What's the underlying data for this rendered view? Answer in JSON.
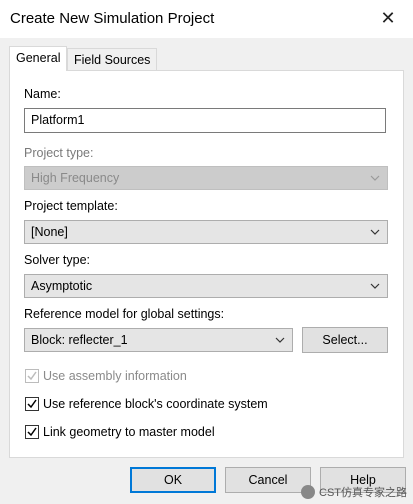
{
  "window": {
    "title": "Create New Simulation Project",
    "close_symbol": "✕"
  },
  "tabs": [
    {
      "label": "General",
      "selected": true
    },
    {
      "label": "Field Sources",
      "selected": false
    }
  ],
  "form": {
    "name_label": "Name:",
    "name_value": "Platform1",
    "project_type_label": "Project type:",
    "project_type_value": "High Frequency",
    "project_template_label": "Project template:",
    "project_template_value": "[None]",
    "solver_type_label": "Solver type:",
    "solver_type_value": "Asymptotic",
    "reference_model_label": "Reference model for global settings:",
    "reference_model_value": "Block: reflecter_1",
    "select_button": "Select...",
    "use_assembly_info": {
      "label": "Use assembly information",
      "checked": true,
      "enabled": false
    },
    "use_reference_block_cs": {
      "label": "Use reference block's coordinate system",
      "checked": true,
      "enabled": true
    },
    "link_geometry": {
      "label": "Link geometry to master model",
      "checked": true,
      "enabled": true
    }
  },
  "footer": {
    "ok": "OK",
    "cancel": "Cancel",
    "help": "Help"
  },
  "watermark": {
    "text": "CST仿真专家之路"
  },
  "colors": {
    "accent": "#0078d7",
    "dialog_bg": "#f0f0f0",
    "combo_bg": "#e5e5e5"
  }
}
